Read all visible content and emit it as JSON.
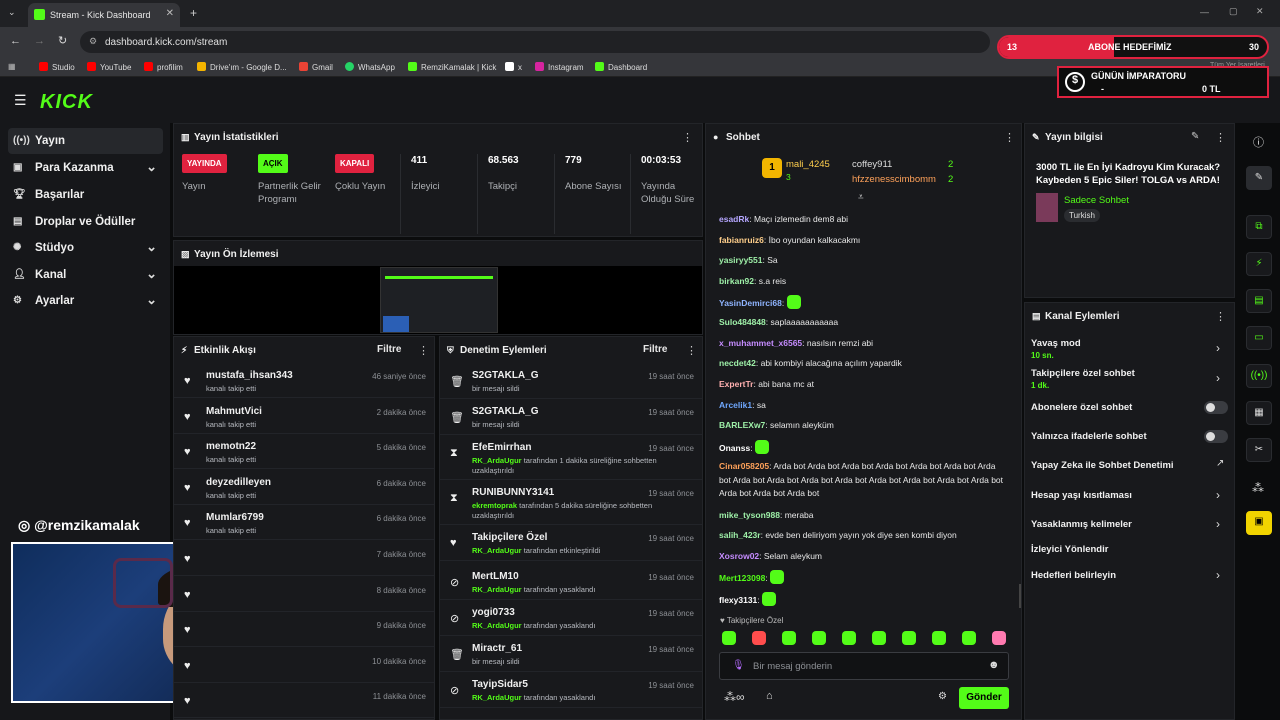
{
  "browser": {
    "tab_title": "Stream - Kick Dashboard",
    "url": "dashboard.kick.com/stream",
    "bookmarks": [
      "Studio",
      "YouTube",
      "profilim",
      "Drive'ım - Google D...",
      "Gmail",
      "WhatsApp",
      "RemziKamalak | Kick",
      "x",
      "Instagram",
      "Dashboard"
    ]
  },
  "overlay": {
    "sub_goal_label": "ABONE HEDEFİMİZ",
    "sub_goal_current": "13",
    "sub_goal_target": "30",
    "emperor_title": "GÜNÜN İMPARATORU",
    "emperor_name": "-",
    "emperor_amount": "0 TL",
    "instagram": "@remzikamalak",
    "small_text": "Tüm Yer İşaretleri"
  },
  "sidebar": {
    "items": [
      {
        "label": "Yayın",
        "icon": "broadcast-icon"
      },
      {
        "label": "Para Kazanma",
        "icon": "money-icon"
      },
      {
        "label": "Başarılar",
        "icon": "trophy-icon"
      },
      {
        "label": "Droplar ve Ödüller",
        "icon": "gift-icon"
      },
      {
        "label": "Stüdyo",
        "icon": "gear-icon"
      },
      {
        "label": "Kanal",
        "icon": "user-icon"
      },
      {
        "label": "Ayarlar",
        "icon": "settings-icon"
      }
    ]
  },
  "stats": {
    "title": "Yayın İstatistikleri",
    "badges": [
      {
        "badge": "YAYINDA",
        "label": "Yayın"
      },
      {
        "badge": "AÇIK",
        "label": "Partnerlik Gelir Programı"
      },
      {
        "badge": "KAPALI",
        "label": "Çoklu Yayın"
      }
    ],
    "numbers": [
      {
        "value": "411",
        "label": "İzleyici"
      },
      {
        "value": "68.563",
        "label": "Takipçi"
      },
      {
        "value": "779",
        "label": "Abone Sayısı"
      },
      {
        "value": "00:03:53",
        "label": "Yayında Olduğu Süre"
      }
    ]
  },
  "preview": {
    "title": "Yayın Ön İzlemesi"
  },
  "activity": {
    "title": "Etkinlik Akışı",
    "filter": "Filtre",
    "items": [
      {
        "name": "mustafa_ihsan343",
        "sub": "kanalı takip etti",
        "time": "46 saniye önce"
      },
      {
        "name": "MahmutVici",
        "sub": "kanalı takip etti",
        "time": "2 dakika önce"
      },
      {
        "name": "memotn22",
        "sub": "kanalı takip etti",
        "time": "5 dakika önce"
      },
      {
        "name": "deyzedilleyen",
        "sub": "kanalı takip etti",
        "time": "6 dakika önce"
      },
      {
        "name": "Mumlar6799",
        "sub": "kanalı takip etti",
        "time": "6 dakika önce"
      },
      {
        "name": "",
        "sub": "",
        "time": "7 dakika önce"
      },
      {
        "name": "",
        "sub": "",
        "time": "8 dakika önce"
      },
      {
        "name": "",
        "sub": "",
        "time": "9 dakika önce"
      },
      {
        "name": "",
        "sub": "",
        "time": "10 dakika önce"
      },
      {
        "name": "",
        "sub": "",
        "time": "11 dakika önce"
      }
    ]
  },
  "moderation": {
    "title": "Denetim Eylemleri",
    "filter": "Filtre",
    "items": [
      {
        "icon": "trash-icon",
        "name": "S2GTAKLA_G",
        "mod": "",
        "sub": "bir mesajı sildi",
        "time": "19 saat önce"
      },
      {
        "icon": "trash-icon",
        "name": "S2GTAKLA_G",
        "mod": "",
        "sub": "bir mesajı sildi",
        "time": "19 saat önce"
      },
      {
        "icon": "hourglass-icon",
        "name": "EfeEmirrhan",
        "mod": "RK_ArdaUgur",
        "sub": "tarafından 1 dakika süreliğine sohbetten uzaklaştırıldı",
        "time": "19 saat önce"
      },
      {
        "icon": "hourglass-icon",
        "name": "RUNIBUNNY3141",
        "mod": "ekremtoprak",
        "sub": "tarafından 5 dakika süreliğine sohbetten uzaklaştırıldı",
        "time": "19 saat önce"
      },
      {
        "icon": "heart-icon",
        "name": "Takipçilere Özel",
        "mod": "RK_ArdaUgur",
        "sub": "tarafından etkinleştirildi",
        "time": "19 saat önce"
      },
      {
        "icon": "ban-icon",
        "name": "MertLM10",
        "mod": "RK_ArdaUgur",
        "sub": "tarafından yasaklandı",
        "time": "19 saat önce"
      },
      {
        "icon": "ban-icon",
        "name": "yogi0733",
        "mod": "RK_ArdaUgur",
        "sub": "tarafından yasaklandı",
        "time": "19 saat önce"
      },
      {
        "icon": "trash-icon",
        "name": "Miractr_61",
        "mod": "",
        "sub": "bir mesajı sildi",
        "time": "19 saat önce"
      },
      {
        "icon": "ban-icon",
        "name": "TayipSidar5",
        "mod": "RK_ArdaUgur",
        "sub": "tarafından yasaklandı",
        "time": "19 saat önce"
      }
    ]
  },
  "chat": {
    "title": "Sohbet",
    "top_gifters": [
      {
        "name": "mali_4245",
        "count": "3"
      },
      {
        "name": "coffey911",
        "count": "2"
      },
      {
        "name": "hfzzenesscimbomm",
        "count": "2"
      }
    ],
    "messages": [
      {
        "user": "esadRk",
        "color": "#b5a6ff",
        "text": "Maçı izlemedin dem8 abi"
      },
      {
        "user": "fabianruiz6",
        "color": "#ffcf8b",
        "text": "İbo oyundan kalkacakmı"
      },
      {
        "user": "yasiryy551",
        "color": "#9ef0a8",
        "text": "Sa"
      },
      {
        "user": "birkan92",
        "color": "#9ef0a8",
        "text": "s.a reis"
      },
      {
        "user": "YasinDemirci68",
        "color": "#8fb4ff",
        "text": ""
      },
      {
        "user": "Sulo484848",
        "color": "#9ef0a8",
        "text": "saplaaaaaaaaaaa"
      },
      {
        "user": "x_muhammet_x6565",
        "color": "#c58cff",
        "text": "nasılsın remzi abi"
      },
      {
        "user": "necdet42",
        "color": "#9ef0a8",
        "text": "abi kombiyi alacağına açılım yapardik"
      },
      {
        "user": "ExpertTr",
        "color": "#ffb0b0",
        "text": "abi bana mc at"
      },
      {
        "user": "Arcelik1",
        "color": "#6fa8ff",
        "text": "sa"
      },
      {
        "user": "BARLEXw7",
        "color": "#9ef0a8",
        "text": "selamın aleyküm"
      },
      {
        "user": "Onanss",
        "color": "#ffffff",
        "text": ""
      },
      {
        "user": "Cinar058205",
        "color": "#ffa25a",
        "text": "Arda bot Arda bot Arda bot Arda bot Arda bot Arda bot Arda bot Arda bot Arda bot Arda bot Arda bot Arda bot Arda bot Arda bot Arda bot Arda bot Arda bot Arda bot"
      },
      {
        "user": "mike_tyson988",
        "color": "#9ef0a8",
        "text": "meraba"
      },
      {
        "user": "salih_423r",
        "color": "#9ef0a8",
        "text": "evde ben deliriyom yayın yok diye sen kombi diyon"
      },
      {
        "user": "Xosrow02",
        "color": "#c58cff",
        "text": "Selam aleykum"
      },
      {
        "user": "Mert123098",
        "color": "#53fc18",
        "text": ""
      },
      {
        "user": "flexy3131",
        "color": "#ffffff",
        "text": ""
      }
    ],
    "followers_only": "Takipçilere Özel",
    "input_placeholder": "Bir mesaj gönderin",
    "send": "Gönder"
  },
  "stream_info": {
    "title": "Yayın bilgisi",
    "stream_title": "3000 TL ile En İyi Kadroyu Kim Kuracak? Kaybeden 5 Epic Siler! TOLGA vs ARDA!",
    "category": "Sadece Sohbet",
    "tag": "Turkish"
  },
  "channel_actions": {
    "title": "Kanal Eylemleri",
    "items": [
      {
        "label": "Yavaş mod",
        "sub": "10 sn.",
        "control": "chevron"
      },
      {
        "label": "Takipçilere özel sohbet",
        "sub": "1 dk.",
        "control": "chevron"
      },
      {
        "label": "Abonelere özel sohbet",
        "sub": "",
        "control": "toggle"
      },
      {
        "label": "Yalnızca ifadelerle sohbet",
        "sub": "",
        "control": "toggle"
      },
      {
        "label": "Yapay Zeka ile Sohbet Denetimi",
        "sub": "",
        "control": "external"
      },
      {
        "label": "Hesap yaşı kısıtlaması",
        "sub": "",
        "control": "chevron"
      },
      {
        "label": "Yasaklanmış kelimeler",
        "sub": "",
        "control": "chevron"
      },
      {
        "label": "İzleyici Yönlendir",
        "sub": "",
        "control": "none"
      },
      {
        "label": "Hedefleri belirleyin",
        "sub": "",
        "control": "chevron"
      }
    ]
  },
  "colors": {
    "accent": "#53fc18",
    "danger": "#e0223f",
    "panel": "#18191c"
  }
}
